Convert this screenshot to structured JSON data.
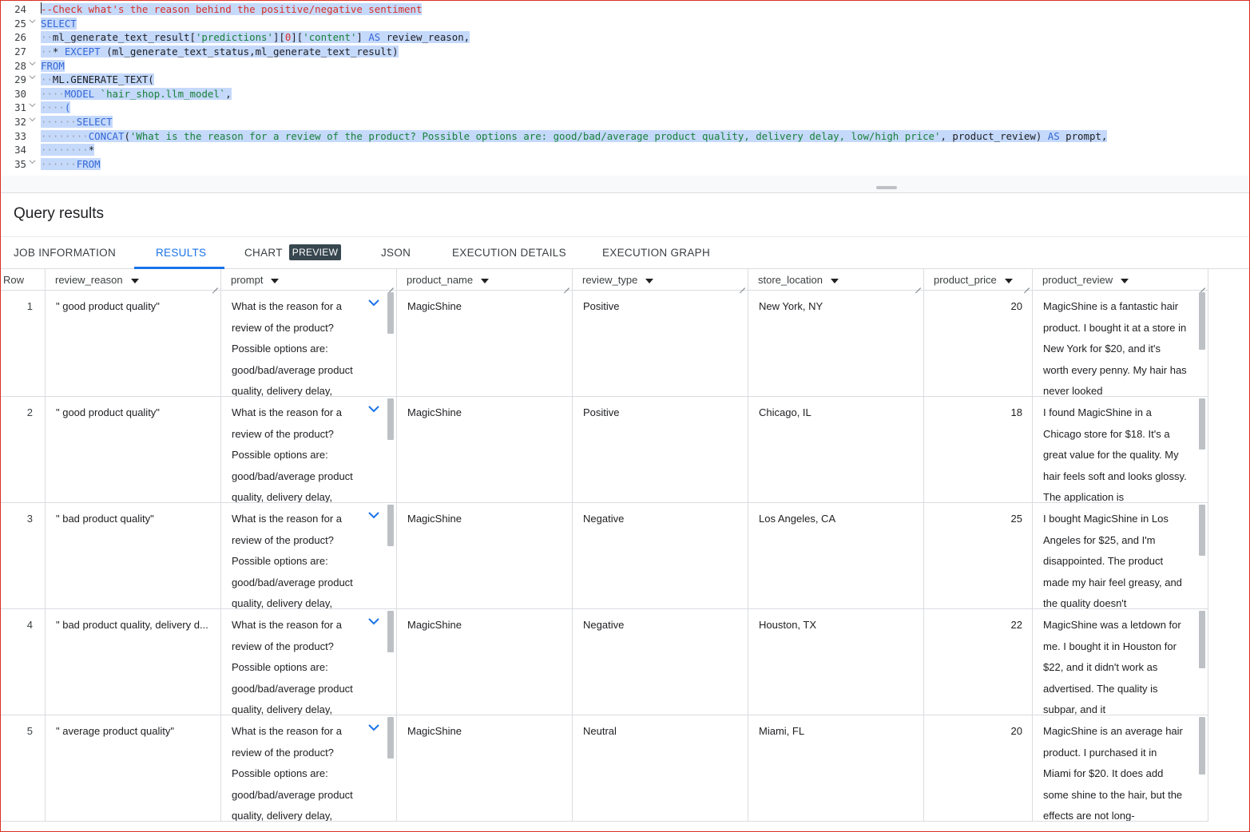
{
  "editor": {
    "lines": [
      {
        "n": "24",
        "fold": "",
        "segs": [
          {
            "t": "--Check what's the reason behind the positive/negative sentiment",
            "c": "cmt"
          }
        ]
      },
      {
        "n": "25",
        "fold": "v",
        "segs": [
          {
            "t": "SELECT",
            "c": "kw"
          }
        ]
      },
      {
        "n": "26",
        "fold": "",
        "segs": [
          {
            "t": "  ",
            "c": "ws"
          },
          {
            "t": "ml_generate_text_result[",
            "c": "plain"
          },
          {
            "t": "'predictions'",
            "c": "str"
          },
          {
            "t": "][",
            "c": "plain"
          },
          {
            "t": "0",
            "c": "num"
          },
          {
            "t": "][",
            "c": "plain"
          },
          {
            "t": "'content'",
            "c": "str"
          },
          {
            "t": "] ",
            "c": "plain"
          },
          {
            "t": "AS",
            "c": "kw"
          },
          {
            "t": " review_reason,",
            "c": "plain"
          }
        ]
      },
      {
        "n": "27",
        "fold": "",
        "segs": [
          {
            "t": "  ",
            "c": "ws"
          },
          {
            "t": "* ",
            "c": "plain"
          },
          {
            "t": "EXCEPT",
            "c": "kw"
          },
          {
            "t": " (ml_generate_text_status,ml_generate_text_result)",
            "c": "plain"
          }
        ]
      },
      {
        "n": "28",
        "fold": "v",
        "segs": [
          {
            "t": "FROM",
            "c": "kw"
          }
        ]
      },
      {
        "n": "29",
        "fold": "v",
        "segs": [
          {
            "t": "  ",
            "c": "ws"
          },
          {
            "t": "ML.GENERATE_TEXT(",
            "c": "plain"
          }
        ]
      },
      {
        "n": "30",
        "fold": "",
        "segs": [
          {
            "t": "    ",
            "c": "ws"
          },
          {
            "t": "MODEL",
            "c": "kw"
          },
          {
            "t": " ",
            "c": "plain"
          },
          {
            "t": "`hair_shop.llm_model`",
            "c": "str"
          },
          {
            "t": ",",
            "c": "plain"
          }
        ]
      },
      {
        "n": "31",
        "fold": "v",
        "segs": [
          {
            "t": "    ",
            "c": "ws"
          },
          {
            "t": "(",
            "c": "kw"
          }
        ]
      },
      {
        "n": "32",
        "fold": "v",
        "segs": [
          {
            "t": "      ",
            "c": "ws"
          },
          {
            "t": "SELECT",
            "c": "kw"
          }
        ]
      },
      {
        "n": "33",
        "fold": "",
        "segs": [
          {
            "t": "        ",
            "c": "ws"
          },
          {
            "t": "CONCAT",
            "c": "kw"
          },
          {
            "t": "(",
            "c": "plain"
          },
          {
            "t": "'What is the reason for a review of the product? Possible options are: good/bad/average product quality, delivery delay, low/high price'",
            "c": "str"
          },
          {
            "t": ", product_review) ",
            "c": "plain"
          },
          {
            "t": "AS",
            "c": "kw"
          },
          {
            "t": " prompt,",
            "c": "plain"
          }
        ]
      },
      {
        "n": "34",
        "fold": "",
        "segs": [
          {
            "t": "        ",
            "c": "ws"
          },
          {
            "t": "*",
            "c": "plain"
          }
        ]
      },
      {
        "n": "35",
        "fold": "v",
        "segs": [
          {
            "t": "      ",
            "c": "ws"
          },
          {
            "t": "FROM",
            "c": "kw"
          }
        ]
      }
    ]
  },
  "results": {
    "title": "Query results",
    "tabs": [
      {
        "label": "JOB INFORMATION"
      },
      {
        "label": "RESULTS"
      },
      {
        "label": "CHART",
        "badge": "PREVIEW"
      },
      {
        "label": "JSON"
      },
      {
        "label": "EXECUTION DETAILS"
      },
      {
        "label": "EXECUTION GRAPH"
      }
    ]
  },
  "table": {
    "columns": [
      "Row",
      "review_reason",
      "prompt",
      "product_name",
      "review_type",
      "store_location",
      "product_price",
      "product_review"
    ],
    "rows": [
      {
        "row": "1",
        "review_reason": "\" good product quality\"",
        "prompt": "What is the reason for a review of the product? Possible options are: good/bad/average product quality, delivery delay,",
        "product_name": "MagicShine",
        "review_type": "Positive",
        "store_location": "New York, NY",
        "product_price": "20",
        "product_review": "MagicShine is a fantastic hair product. I bought it at a store in New York for $20, and it's worth every penny. My hair has never looked"
      },
      {
        "row": "2",
        "review_reason": "\" good product quality\"",
        "prompt": "What is the reason for a review of the product? Possible options are: good/bad/average product quality, delivery delay,",
        "product_name": "MagicShine",
        "review_type": "Positive",
        "store_location": "Chicago, IL",
        "product_price": "18",
        "product_review": "I found MagicShine in a Chicago store for $18. It's a great value for the quality. My hair feels soft and looks glossy. The application is"
      },
      {
        "row": "3",
        "review_reason": "\" bad product quality\"",
        "prompt": "What is the reason for a review of the product? Possible options are: good/bad/average product quality, delivery delay,",
        "product_name": "MagicShine",
        "review_type": "Negative",
        "store_location": "Los Angeles, CA",
        "product_price": "25",
        "product_review": "I bought MagicShine in Los Angeles for $25, and I'm disappointed. The product made my hair feel greasy, and the quality doesn't"
      },
      {
        "row": "4",
        "review_reason": "\" bad product quality, delivery d...",
        "prompt": "What is the reason for a review of the product? Possible options are: good/bad/average product quality, delivery delay,",
        "product_name": "MagicShine",
        "review_type": "Negative",
        "store_location": "Houston, TX",
        "product_price": "22",
        "product_review": "MagicShine was a letdown for me. I bought it in Houston for $22, and it didn't work as advertised. The quality is subpar, and it"
      },
      {
        "row": "5",
        "review_reason": "\" average product quality\"",
        "prompt": "What is the reason for a review of the product? Possible options are: good/bad/average product quality, delivery delay,",
        "product_name": "MagicShine",
        "review_type": "Neutral",
        "store_location": "Miami, FL",
        "product_price": "20",
        "product_review": "MagicShine is an average hair product. I purchased it in Miami for $20. It does add some shine to the hair, but the effects are not long-"
      }
    ]
  }
}
